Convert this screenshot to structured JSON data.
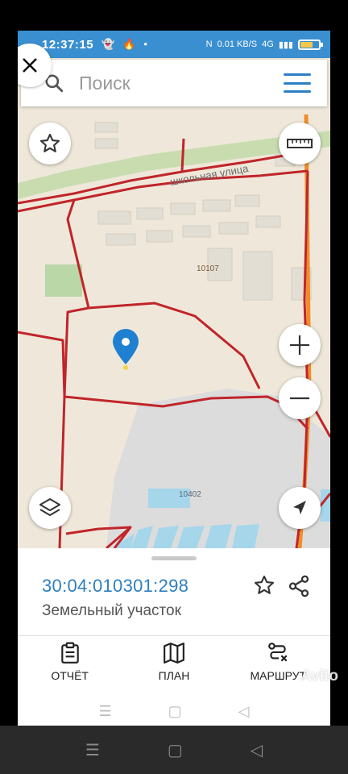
{
  "status_bar": {
    "time": "12:37:15",
    "icons": [
      "snapchat-icon",
      "flame-icon",
      "dot-icon"
    ],
    "net_speed": "0.01 KB/S",
    "signal": "4G"
  },
  "search": {
    "placeholder": "Поиск"
  },
  "map": {
    "street_label": "школьная улица",
    "parcel_labels": [
      "10107",
      "10402"
    ],
    "road_color": "#f28c28",
    "boundary_color": "#c0252a",
    "marker_color": "#1f7fd0"
  },
  "parcel": {
    "cadastral_number": "30:04:010301:298",
    "type": "Земельный участок"
  },
  "tabs": [
    {
      "label": "ОТЧЁТ",
      "icon": "report-icon"
    },
    {
      "label": "ПЛАН",
      "icon": "map-plan-icon"
    },
    {
      "label": "МАРШРУТ",
      "icon": "route-icon"
    }
  ],
  "watermark": "Avito",
  "colors": {
    "accent": "#2d7fc4",
    "status_bar": "#3a8fd0"
  }
}
